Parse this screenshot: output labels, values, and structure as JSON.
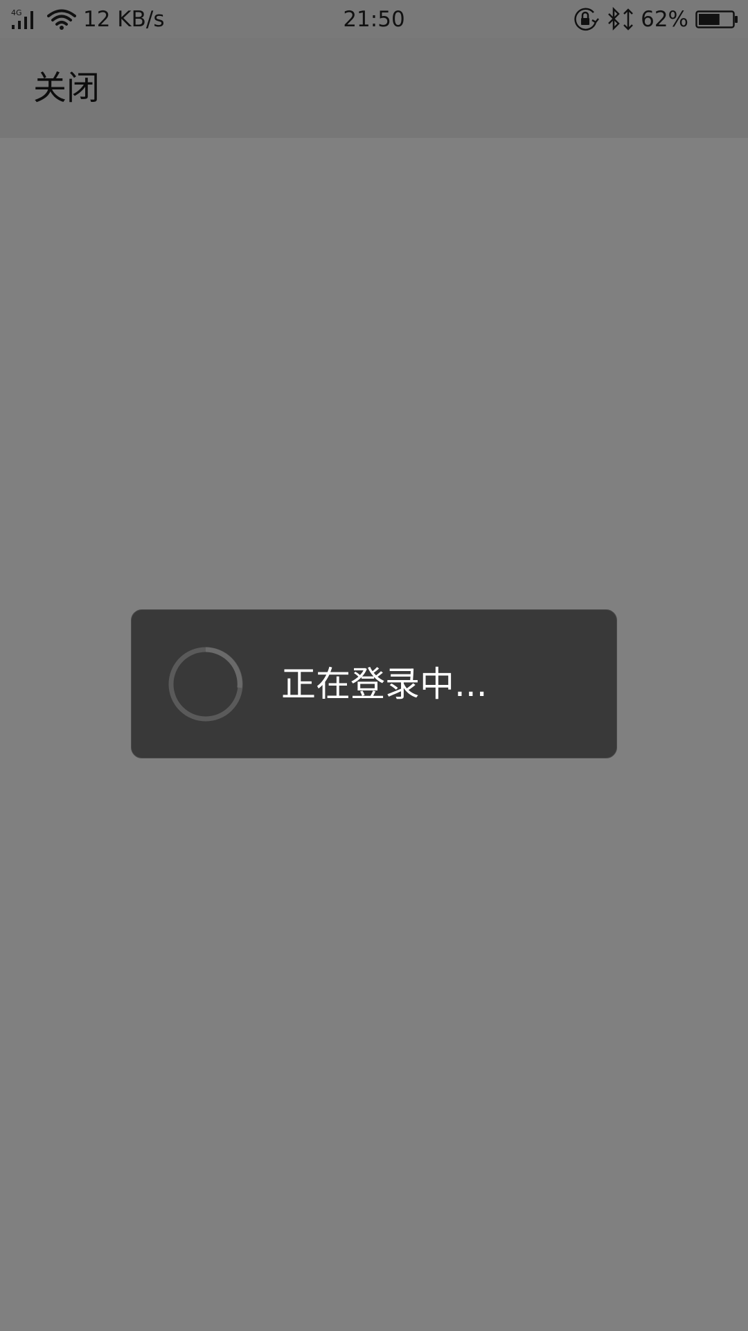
{
  "status_bar": {
    "network": "4G",
    "net_speed": "12 KB/s",
    "time": "21:50",
    "battery_percent": "62%",
    "battery_level": 0.62,
    "icons": [
      "signal-icon",
      "wifi-icon",
      "rotation-lock-icon",
      "bluetooth-icon",
      "battery-icon"
    ]
  },
  "app_bar": {
    "close_label": "关闭"
  },
  "dialog": {
    "message": "正在登录中..."
  },
  "colors": {
    "overlay": "#808080",
    "dialog_bg": "#393939",
    "dialog_text": "#ffffff"
  }
}
